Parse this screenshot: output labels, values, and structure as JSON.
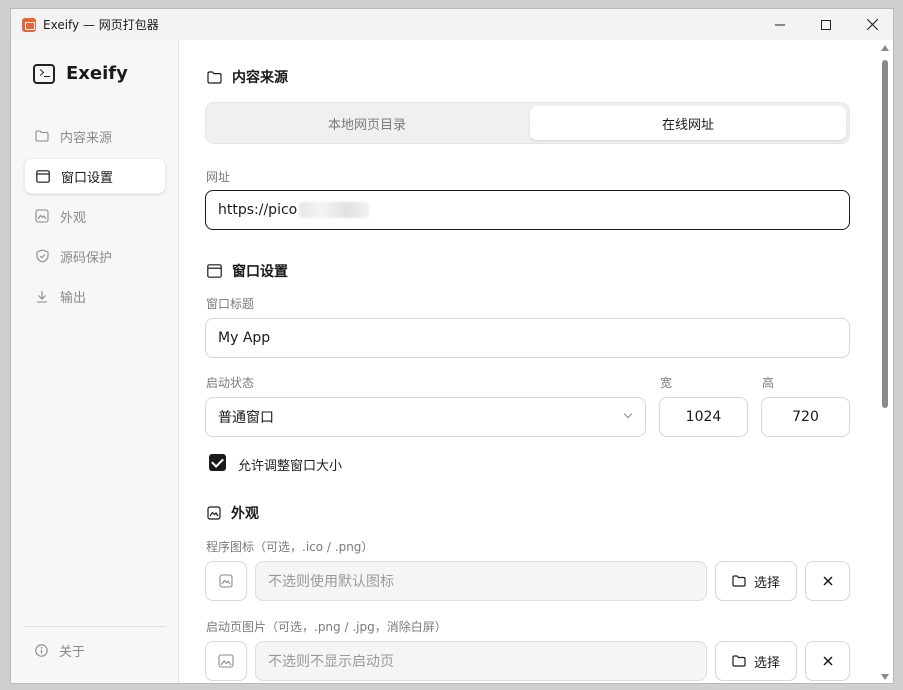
{
  "window": {
    "title": "Exeify — 网页打包器"
  },
  "sidebar": {
    "brand": "Exeify",
    "items": [
      {
        "label": "内容来源",
        "icon": "folder-icon"
      },
      {
        "label": "窗口设置",
        "icon": "window-icon"
      },
      {
        "label": "外观",
        "icon": "image-icon"
      },
      {
        "label": "源码保护",
        "icon": "shield-icon"
      },
      {
        "label": "输出",
        "icon": "download-icon"
      }
    ],
    "about": "关于"
  },
  "content_source": {
    "title": "内容来源",
    "tabs": [
      "本地网页目录",
      "在线网址"
    ],
    "selected_tab": "在线网址",
    "url_label": "网址",
    "url_value": "https://pico"
  },
  "window_settings": {
    "title": "窗口设置",
    "window_title_label": "窗口标题",
    "window_title_value": "My App",
    "startup_label": "启动状态",
    "startup_value": "普通窗口",
    "width_label": "宽",
    "width_value": "1024",
    "height_label": "高",
    "height_value": "720",
    "resizable_label": "允许调整窗口大小",
    "resizable_checked": true
  },
  "appearance": {
    "title": "外观",
    "icon_label": "程序图标（可选，.ico / .png）",
    "icon_placeholder": "不选则使用默认图标",
    "splash_label": "启动页图片（可选，.png / .jpg，消除白屏）",
    "splash_placeholder": "不选则不显示启动页",
    "choose_label": "选择"
  }
}
